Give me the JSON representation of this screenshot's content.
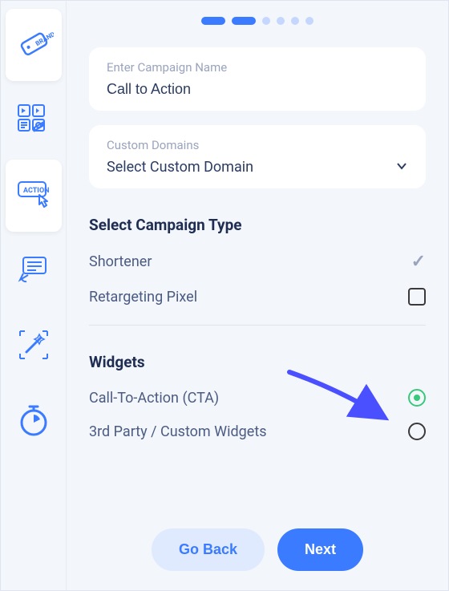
{
  "sidebar": {
    "items": [
      {
        "name": "brand-icon"
      },
      {
        "name": "media-icon"
      },
      {
        "name": "action-icon"
      },
      {
        "name": "announce-icon"
      },
      {
        "name": "wand-icon"
      },
      {
        "name": "timer-icon"
      }
    ]
  },
  "progress": {
    "current": 2,
    "total": 6
  },
  "campaign_name": {
    "label": "Enter Campaign Name",
    "value": "Call to Action"
  },
  "custom_domain": {
    "label": "Custom Domains",
    "placeholder": "Select Custom Domain"
  },
  "campaign_type": {
    "title": "Select Campaign Type",
    "options": [
      {
        "label": "Shortener",
        "state": "check"
      },
      {
        "label": "Retargeting Pixel",
        "state": "checkbox"
      }
    ]
  },
  "widgets": {
    "title": "Widgets",
    "options": [
      {
        "label": "Call-To-Action (CTA)",
        "selected": true
      },
      {
        "label": "3rd Party / Custom Widgets",
        "selected": false
      }
    ]
  },
  "footer": {
    "back": "Go Back",
    "next": "Next"
  }
}
